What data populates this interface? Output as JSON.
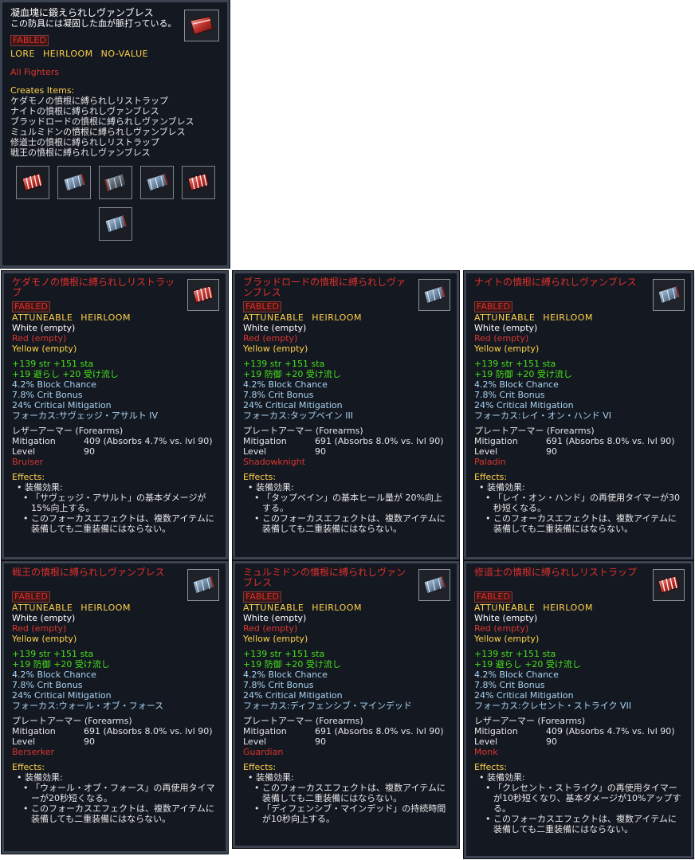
{
  "source_item": {
    "title": "凝血塊に鍛えられしヴァンブレス",
    "desc": "この防具には凝固した血が脈打っている。",
    "fabled": "FABLED",
    "tags": "LORE  HEIRLOOM  NO-VALUE",
    "class_restriction": "All Fighters",
    "creates_label": "Creates Items:",
    "creates": [
      "ケダモノの憤根に縛られしリストラップ",
      "ナイトの憤根に縛られしヴァンブレス",
      "ブラッドロードの憤根に縛られしヴァンブレス",
      "ミュルミドンの憤根に縛られしヴァンブレス",
      "修道士の憤根に縛られしリストラップ",
      "戦王の憤根に縛られしヴァンブレス"
    ],
    "icons": [
      "wristwrap-red-icon",
      "vambrace-steel-icon",
      "vambrace-dark-icon",
      "vambrace-steel-icon",
      "wristwrap-red-icon",
      "vambrace-steel-icon"
    ]
  },
  "items": [
    {
      "title": "ケダモノの憤根に縛られしリストラップ",
      "icon": "wristwrap-red-icon",
      "fabled": "FABLED",
      "tags": "ATTUNEABLE  HEIRLOOM",
      "white": "White (empty)",
      "red": "Red (empty)",
      "yellow": "Yellow (empty)",
      "stats_green": [
        "+139 str  +151 sta",
        "+19 避らし +20 受け流し"
      ],
      "stats_cyan": [
        "4.2% Block Chance",
        "7.8% Crit Bonus",
        "24% Critical Mitigation",
        "フォーカス:サヴェッジ・アサルト IV"
      ],
      "armor_type": "レザーアーマー (Forearms)",
      "mitigation_label": "Mitigation",
      "mitigation_value": "409 (Absorbs 4.7% vs. lvl 90)",
      "level_label": "Level",
      "level_value": "90",
      "class": "Bruiser",
      "effects_label": "Effects:",
      "effect_head": "装備効果:",
      "effect_lines": [
        "「サヴェッジ・アサルト」の基本ダメージが15%向上する。",
        "このフォーカスエフェクトは、複数アイテムに装備しても二重装備にはならない。"
      ]
    },
    {
      "title": "ブラッドロードの憤根に縛られしヴァンブレス",
      "icon": "vambrace-steel-icon",
      "fabled": "FABLED",
      "tags": "ATTUNEABLE  HEIRLOOM",
      "white": "White (empty)",
      "red": "Red (empty)",
      "yellow": "Yellow (empty)",
      "stats_green": [
        "+139 str  +151 sta",
        "+19 防御 +20 受け流し"
      ],
      "stats_cyan": [
        "4.2% Block Chance",
        "7.8% Crit Bonus",
        "24% Critical Mitigation",
        "フォーカス:タップベイン III"
      ],
      "armor_type": "プレートアーマー (Forearms)",
      "mitigation_label": "Mitigation",
      "mitigation_value": "691 (Absorbs 8.0% vs. lvl 90)",
      "level_label": "Level",
      "level_value": "90",
      "class": "Shadowknight",
      "effects_label": "Effects:",
      "effect_head": "装備効果:",
      "effect_lines": [
        "「タップベイン」の基本ヒール量が 20%向上する。",
        "このフォーカスエフェクトは、複数アイテムに装備しても二重装備にはならない。"
      ]
    },
    {
      "title": "ナイトの憤根に縛られしヴァンブレス",
      "icon": "vambrace-steel-icon",
      "fabled": "FABLED",
      "tags": "ATTUNEABLE  HEIRLOOM",
      "white": "White (empty)",
      "red": "Red (empty)",
      "yellow": "Yellow (empty)",
      "stats_green": [
        "+139 str  +151 sta",
        "+19 防御 +20 受け流し"
      ],
      "stats_cyan": [
        "4.2% Block Chance",
        "7.8% Crit Bonus",
        "24% Critical Mitigation",
        "フォーカス:レイ・オン・ハンド VI"
      ],
      "armor_type": "プレートアーマー (Forearms)",
      "mitigation_label": "Mitigation",
      "mitigation_value": "691 (Absorbs 8.0% vs. lvl 90)",
      "level_label": "Level",
      "level_value": "90",
      "class": "Paladin",
      "effects_label": "Effects:",
      "effect_head": "装備効果:",
      "effect_lines": [
        "「レイ・オン・ハンド」の再使用タイマーが30秒短くなる。",
        "このフォーカスエフェクトは、複数アイテムに装備しても二重装備にはならない。"
      ]
    },
    {
      "title": "戦王の憤根に縛られしヴァンブレス",
      "icon": "vambrace-steel-icon",
      "fabled": "FABLED",
      "tags": "ATTUNEABLE  HEIRLOOM",
      "white": "White (empty)",
      "red": "Red (empty)",
      "yellow": "Yellow (empty)",
      "stats_green": [
        "+139 str  +151 sta",
        "+19 防御 +20 受け流し"
      ],
      "stats_cyan": [
        "4.2% Block Chance",
        "7.8% Crit Bonus",
        "24% Critical Mitigation",
        "フォーカス:ウォール・オブ・フォース"
      ],
      "armor_type": "プレートアーマー (Forearms)",
      "mitigation_label": "Mitigation",
      "mitigation_value": "691 (Absorbs 8.0% vs. lvl 90)",
      "level_label": "Level",
      "level_value": "90",
      "class": "Berserker",
      "effects_label": "Effects:",
      "effect_head": "装備効果:",
      "effect_lines": [
        "「ウォール・オブ・フォース」の再使用タイマーが20秒短くなる。",
        "このフォーカスエフェクトは、複数アイテムに装備しても二重装備にはならない。"
      ]
    },
    {
      "title": "ミュルミドンの憤根に縛られしヴァンブレス",
      "icon": "vambrace-steel-icon",
      "fabled": "FABLED",
      "tags": "ATTUNEABLE  HEIRLOOM",
      "white": "White (empty)",
      "red": "Red (empty)",
      "yellow": "Yellow (empty)",
      "stats_green": [
        "+139 str  +151 sta",
        "+19 防御 +20 受け流し"
      ],
      "stats_cyan": [
        "4.2% Block Chance",
        "7.8% Crit Bonus",
        "24% Critical Mitigation",
        "フォーカス:ディフェンシブ・マインデッド"
      ],
      "armor_type": "プレートアーマー (Forearms)",
      "mitigation_label": "Mitigation",
      "mitigation_value": "691 (Absorbs 8.0% vs. lvl 90)",
      "level_label": "Level",
      "level_value": "90",
      "class": "Guardian",
      "effects_label": "Effects:",
      "effect_head": "装備効果:",
      "effect_lines": [
        "このフォーカスエフェクトは、複数アイテムに装備しても二重装備にはならない。",
        "「ディフェンシブ・マインデッド」の持続時間が10秒向上する。"
      ]
    },
    {
      "title": "修道士の憤根に縛られしリストラップ",
      "icon": "wristwrap-red-icon",
      "fabled": "FABLED",
      "tags": "ATTUNEABLE  HEIRLOOM",
      "white": "White (empty)",
      "red": "Red (empty)",
      "yellow": "Yellow (empty)",
      "stats_green": [
        "+139 str  +151 sta",
        "+19 避らし +20 受け流し"
      ],
      "stats_cyan": [
        "4.2% Block Chance",
        "7.8% Crit Bonus",
        "24% Critical Mitigation",
        "フォーカス:クレセント・ストライク VII"
      ],
      "armor_type": "レザーアーマー (Forearms)",
      "mitigation_label": "Mitigation",
      "mitigation_value": "409 (Absorbs 4.7% vs. lvl 90)",
      "level_label": "Level",
      "level_value": "90",
      "class": "Monk",
      "effects_label": "Effects:",
      "effect_head": "装備効果:",
      "effect_lines": [
        "「クレセント・ストライク」の再使用タイマーが10秒短くなり、基本ダメージが10%アップする。",
        "このフォーカスエフェクトは、複数アイテムに装備しても二重装備にはならない。"
      ]
    }
  ]
}
